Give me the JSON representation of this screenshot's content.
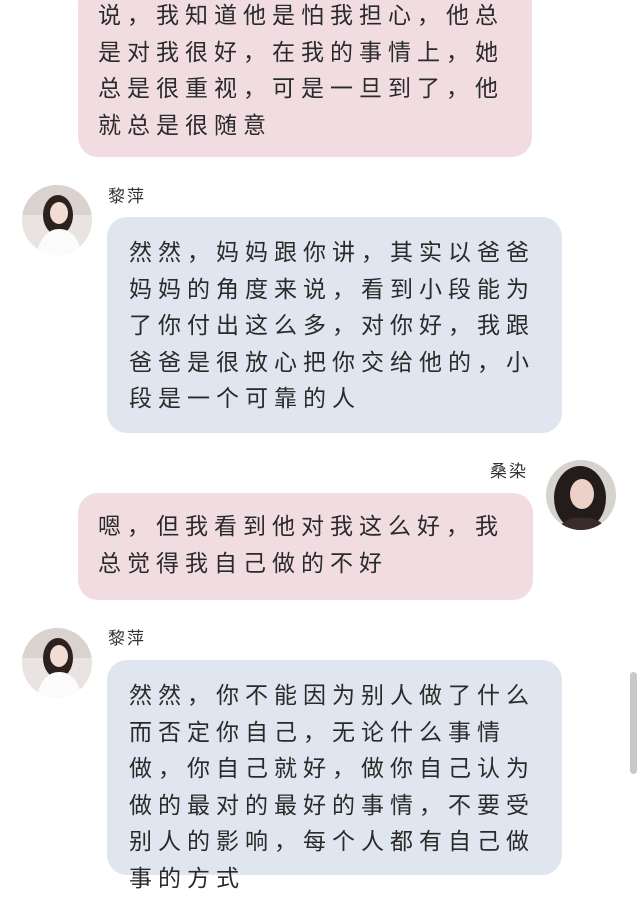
{
  "messages": [
    {
      "sender": "",
      "side": "right",
      "text": "说，我知道他是怕我担心，他总是对我很好，在我的事情上，她总是很重视，可是一旦到了，他就总是很随意"
    },
    {
      "sender": "黎萍",
      "side": "left",
      "text": "然然，妈妈跟你讲，其实以爸爸妈妈的角度来说，看到小段能为了你付出这么多，对你好，我跟爸爸是很放心把你交给他的，小段是一个可靠的人"
    },
    {
      "sender": "桑染",
      "side": "right",
      "text": "嗯，但我看到他对我这么好，我总觉得我自己做的不好"
    },
    {
      "sender": "黎萍",
      "side": "left",
      "text": "然然，你不能因为别人做了什么而否定你自己，无论什么事情做，你自己就好，做你自己认为做的最对的最好的事情，不要受别人的影响，每个人都有自己做事的方式"
    }
  ],
  "colors": {
    "right_bubble": "#f1dde1",
    "left_bubble": "#e0e6ef"
  }
}
